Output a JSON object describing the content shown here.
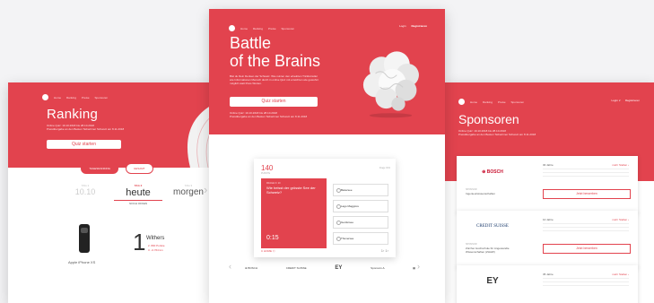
{
  "left": {
    "nav": [
      "Home",
      "Ranking",
      "Preise",
      "Sponsoren"
    ],
    "title": "Ranking",
    "info_lines": [
      "Online Quiz: 19.10.2018 bis 28.10.2018",
      "Preisübergabe an den Besten Teilnehmer Schweiz am 8.11.2018"
    ],
    "button": "Quiz starten",
    "pill_active": "TAGESRANKING",
    "pill_inactive": "GESAMT",
    "day_prev": {
      "label": "TAG 1",
      "value": "10.10",
      "sub": ""
    },
    "day_cur": {
      "label": "TAG 2",
      "value": "heute",
      "sub": "NOCH OFFEN"
    },
    "day_next": {
      "label": "TAG 3",
      "value": "morgen"
    },
    "arrow_right": "›",
    "prize_label": "Apple iPhone XS",
    "rank": "1",
    "winner": "Withers",
    "scores": [
      "2. 800 Punkte",
      "3. -0.764 km"
    ]
  },
  "center": {
    "nav": [
      "Home",
      "Ranking",
      "Preise",
      "Sponsoren"
    ],
    "nav_right": [
      "Login",
      "Registrieren"
    ],
    "title_line1": "Battle",
    "title_line2": "of the Brains",
    "desc": "Bist du Dein Denken der Schweiz. Wie nutzen den erlaubten Trickkünstler wie Informationen Mensch durch in online Quiz mit erreichten wie gewohnt möglich statt Preis Worten.",
    "button": "Quiz starten",
    "dates": [
      "Online Quiz: 19.10.2018 bis 28.10.2018",
      "Preisübergabe an den Besten Teilnehmer Schweiz am 8.11.2018"
    ],
    "quiz": {
      "points": "140",
      "points_label": "PUNKTE",
      "right_label": "Frage 3/10",
      "question_label": "FRAGE 3 / 10",
      "question": "Wie heisst der grösste See der Schweiz?",
      "timer": "0:15",
      "answers": [
        "Bielersee",
        "Lago Maggiore",
        "Genfersee",
        "Thunersee"
      ],
      "footer": "C  HOME  ⬡",
      "nav": "1›   1›"
    },
    "sponsors": [
      "⊕ BOSCH",
      "CREDIT SUISSE",
      "EY",
      "Sponsors ∆",
      "▦"
    ]
  },
  "right": {
    "nav": [
      "Home",
      "Ranking",
      "Preise",
      "Sponsoren"
    ],
    "nav_right": [
      "Login ∨",
      "Registrieren"
    ],
    "title": "Sponsoren",
    "info_lines": [
      "Online Quiz: 19.10.2018 bis 28.10.2018",
      "Preisübergabe an den Besten Teilnehmer Schweiz am 8.11.2018"
    ],
    "sponsors": [
      {
        "logo": "⊕ BOSCH",
        "category": "SPONSOR",
        "name": "Ingenieurwissenschaften",
        "pct": "30 Jahre",
        "more": "mehr Stellen ›",
        "button": "Jetzt bewerben"
      },
      {
        "logo": "CREDIT SUISSE",
        "category": "SPONSOR",
        "name": "Zürcher Hochschule für Angewandte Wissenschaften (ZHAW)",
        "pct": "10 Jahre",
        "more": "mehr Stellen ›",
        "button": "Jetzt bewerben"
      },
      {
        "logo": "EY",
        "category": "",
        "name": "",
        "pct": "35 Jahre",
        "more": "mehr Stellen ›",
        "button": ""
      }
    ]
  }
}
